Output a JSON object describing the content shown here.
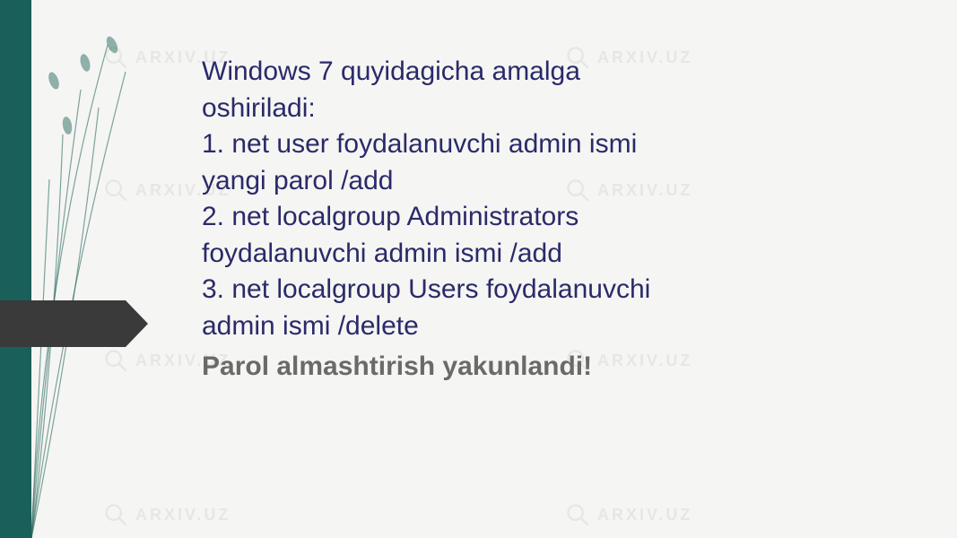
{
  "watermark_text": "ARXIV.UZ",
  "content": {
    "line1": "Windows 7 quyidagicha amalga",
    "line2": "oshiriladi:",
    "line3": "1. net user foydalanuvchi admin ismi",
    "line4": "yangi parol /add",
    "line5": "2. net localgroup Administrators",
    "line6": "foydalanuvchi admin ismi /add",
    "line7": "3. net localgroup Users foydalanuvchi",
    "line8": "admin ismi /delete",
    "line9": "Parol almashtirish yakunlandi!"
  }
}
